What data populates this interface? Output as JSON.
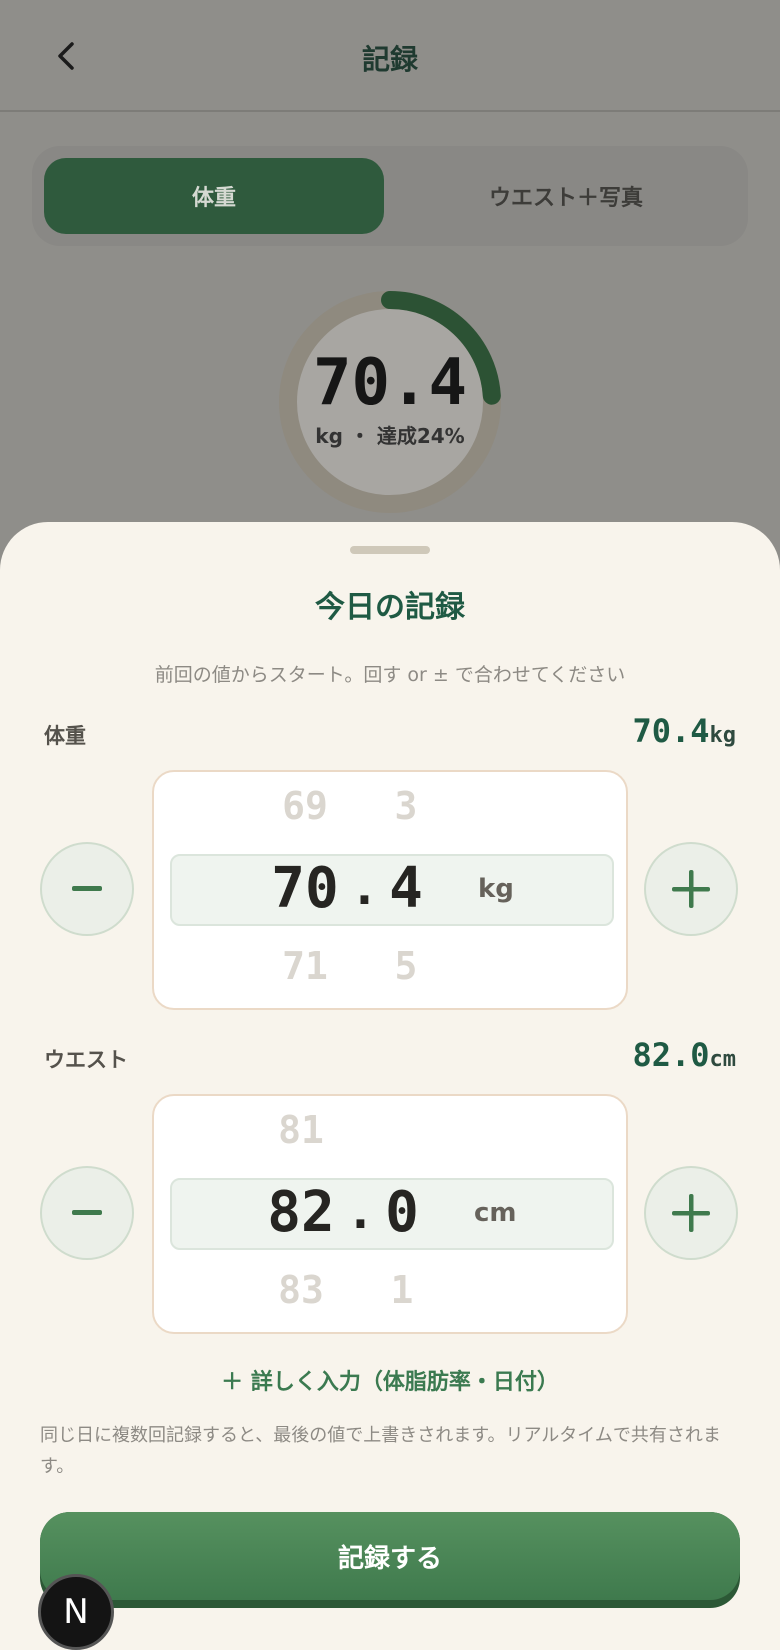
{
  "header": {
    "title": "記録",
    "back_icon": "chevron-left-icon"
  },
  "segment": {
    "tabs": [
      {
        "label": "体重",
        "active": true
      },
      {
        "label": "ウエスト＋写真",
        "active": false
      }
    ]
  },
  "progress": {
    "value": "70.4",
    "subtitle": "kg ・ 達成24%",
    "percent": 24
  },
  "sheet": {
    "title": "今日の記録",
    "hint": "前回の値からスタート。回す or ± で合わせてください",
    "weight": {
      "label": "体重",
      "value": "70.4",
      "unit": "kg",
      "decrease_label": "−",
      "increase_label": "＋",
      "int_prev": "69",
      "int_current": "70",
      "int_next": "71",
      "dec_prev": "3",
      "dec_current": "4",
      "dec_next": "5",
      "separator": ".",
      "picker_unit": "kg"
    },
    "waist": {
      "label": "ウエスト",
      "value": "82.0",
      "unit": "cm",
      "decrease_label": "−",
      "increase_label": "＋",
      "int_prev": "81",
      "int_current": "82",
      "int_next": "83",
      "dec_prev": "",
      "dec_current": "0",
      "dec_next": "1",
      "separator": ".",
      "picker_unit": "cm"
    },
    "detail_link": "＋ 詳しく入力（体脂肪率・日付）",
    "note": "同じ日に複数回記録すると、最後の値で上書きされます。リアルタイムで共有されます。",
    "submit_label": "記録する"
  },
  "badge": {
    "label": "N"
  },
  "colors": {
    "accent": "#2f5a3d",
    "primary_button": "#4a8757",
    "title_green": "#1f5a44",
    "sheet_bg": "#f8f4ec"
  }
}
